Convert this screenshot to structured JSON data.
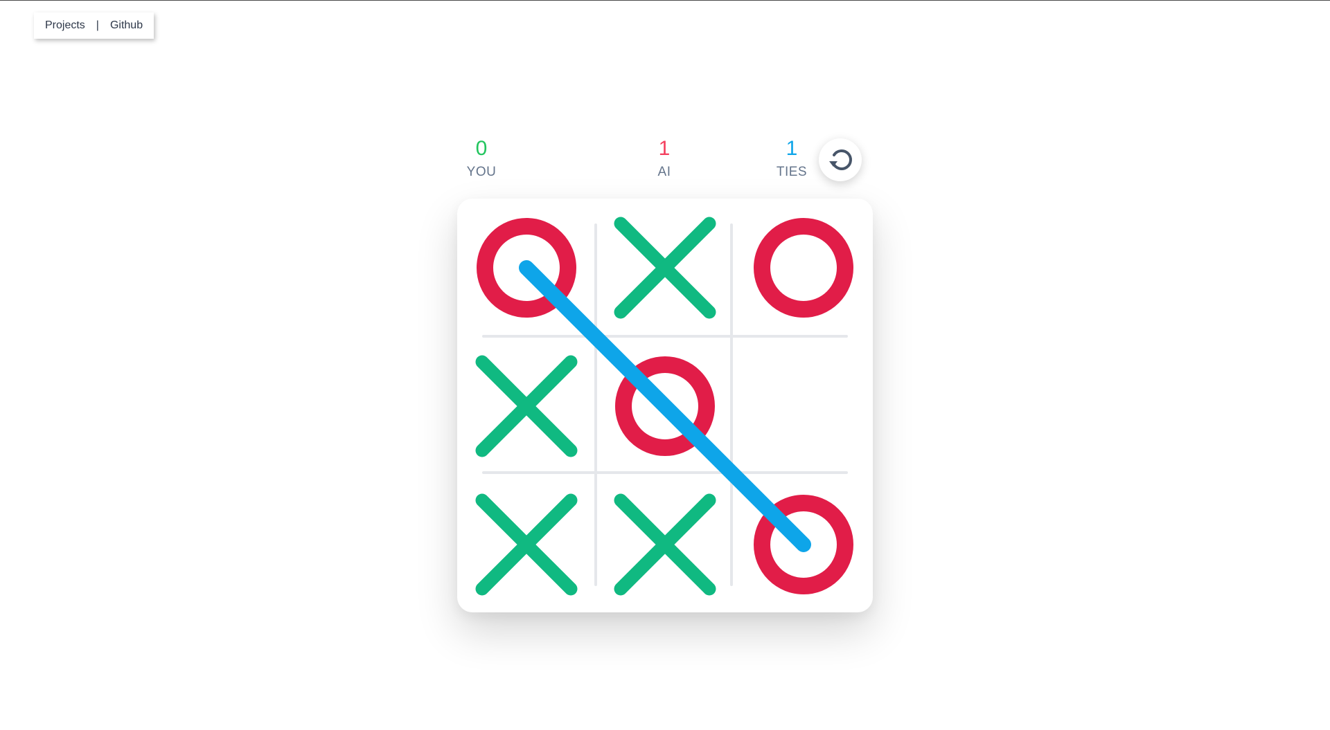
{
  "nav": {
    "projects_label": "Projects",
    "separator": "|",
    "github_label": "Github"
  },
  "scores": {
    "you": {
      "value": "0",
      "label": "YOU",
      "color": "#22c55e"
    },
    "ai": {
      "value": "1",
      "label": "AI",
      "color": "#f43f5e"
    },
    "ties": {
      "value": "1",
      "label": "TIES",
      "color": "#0ea5e9"
    }
  },
  "reset_button": {
    "icon": "reset-icon"
  },
  "board": {
    "cells": [
      "O",
      "X",
      "O",
      "X",
      "O",
      "",
      "X",
      "X",
      "O"
    ],
    "winning_line": [
      0,
      4,
      8
    ],
    "colors": {
      "x": "#10b981",
      "o": "#e11d48",
      "win_line": "#0ea5e9",
      "grid": "#e5e7eb"
    }
  }
}
